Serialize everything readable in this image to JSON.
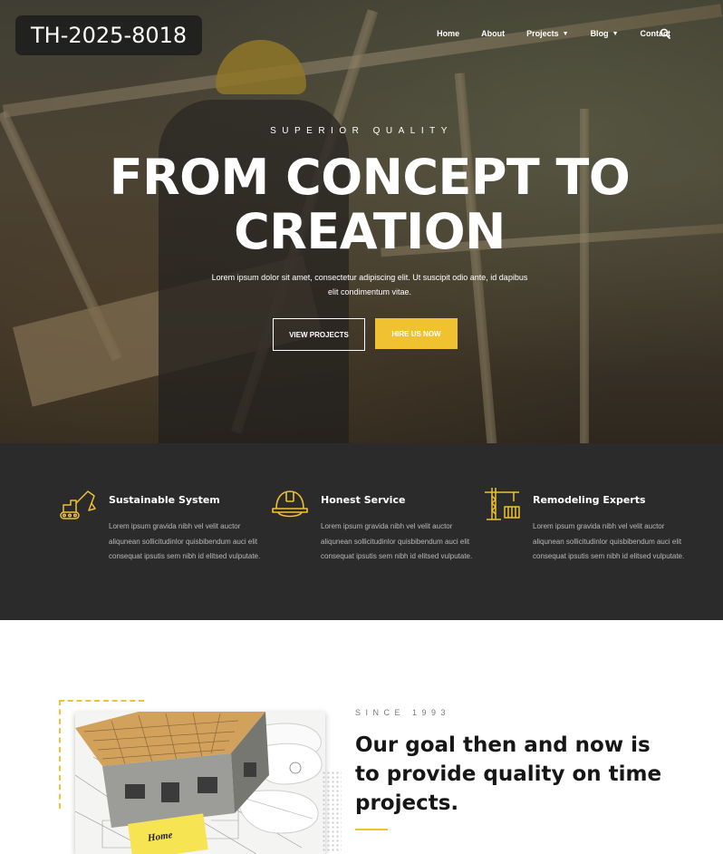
{
  "badge": {
    "text": "TH-2025-8018"
  },
  "nav": {
    "items": [
      {
        "label": "Home",
        "dropdown": false
      },
      {
        "label": "About",
        "dropdown": false
      },
      {
        "label": "Projects",
        "dropdown": true
      },
      {
        "label": "Blog",
        "dropdown": true
      },
      {
        "label": "Contact",
        "dropdown": false
      }
    ],
    "search_icon": "search-icon"
  },
  "hero": {
    "eyebrow": "SUPERIOR QUALITY",
    "headline": "FROM CONCEPT TO CREATION",
    "subtext": "Lorem ipsum dolor sit amet, consectetur adipiscing elit. Ut suscipit odio ante, id dapibus elit condimentum vitae.",
    "btn_outline": "VIEW PROJECTS",
    "btn_solid": "HIRE US NOW"
  },
  "features": [
    {
      "icon": "excavator-icon",
      "title": "Sustainable System",
      "text": "Lorem ipsum gravida nibh vel velit auctor aliqunean sollicitudinlor quisbibendum auci elit consequat ipsutis sem nibh id elitsed vulputate."
    },
    {
      "icon": "hard-hat-icon",
      "title": "Honest Service",
      "text": "Lorem ipsum gravida nibh vel velit auctor aliqunean sollicitudinlor quisbibendum auci elit consequat ipsutis sem nibh id elitsed vulputate."
    },
    {
      "icon": "crane-icon",
      "title": "Remodeling Experts",
      "text": "Lorem ipsum gravida nibh vel velit auctor aliqunean sollicitudinlor quisbibendum auci elit consequat ipsutis sem nibh id elitsed vulputate."
    }
  ],
  "about": {
    "since": "SINCE 1993",
    "title": "Our goal then and now is to provide quality on time projects.",
    "note_text": "Home"
  },
  "colors": {
    "accent": "#f0c230",
    "dark_band": "#2b2b2b"
  }
}
